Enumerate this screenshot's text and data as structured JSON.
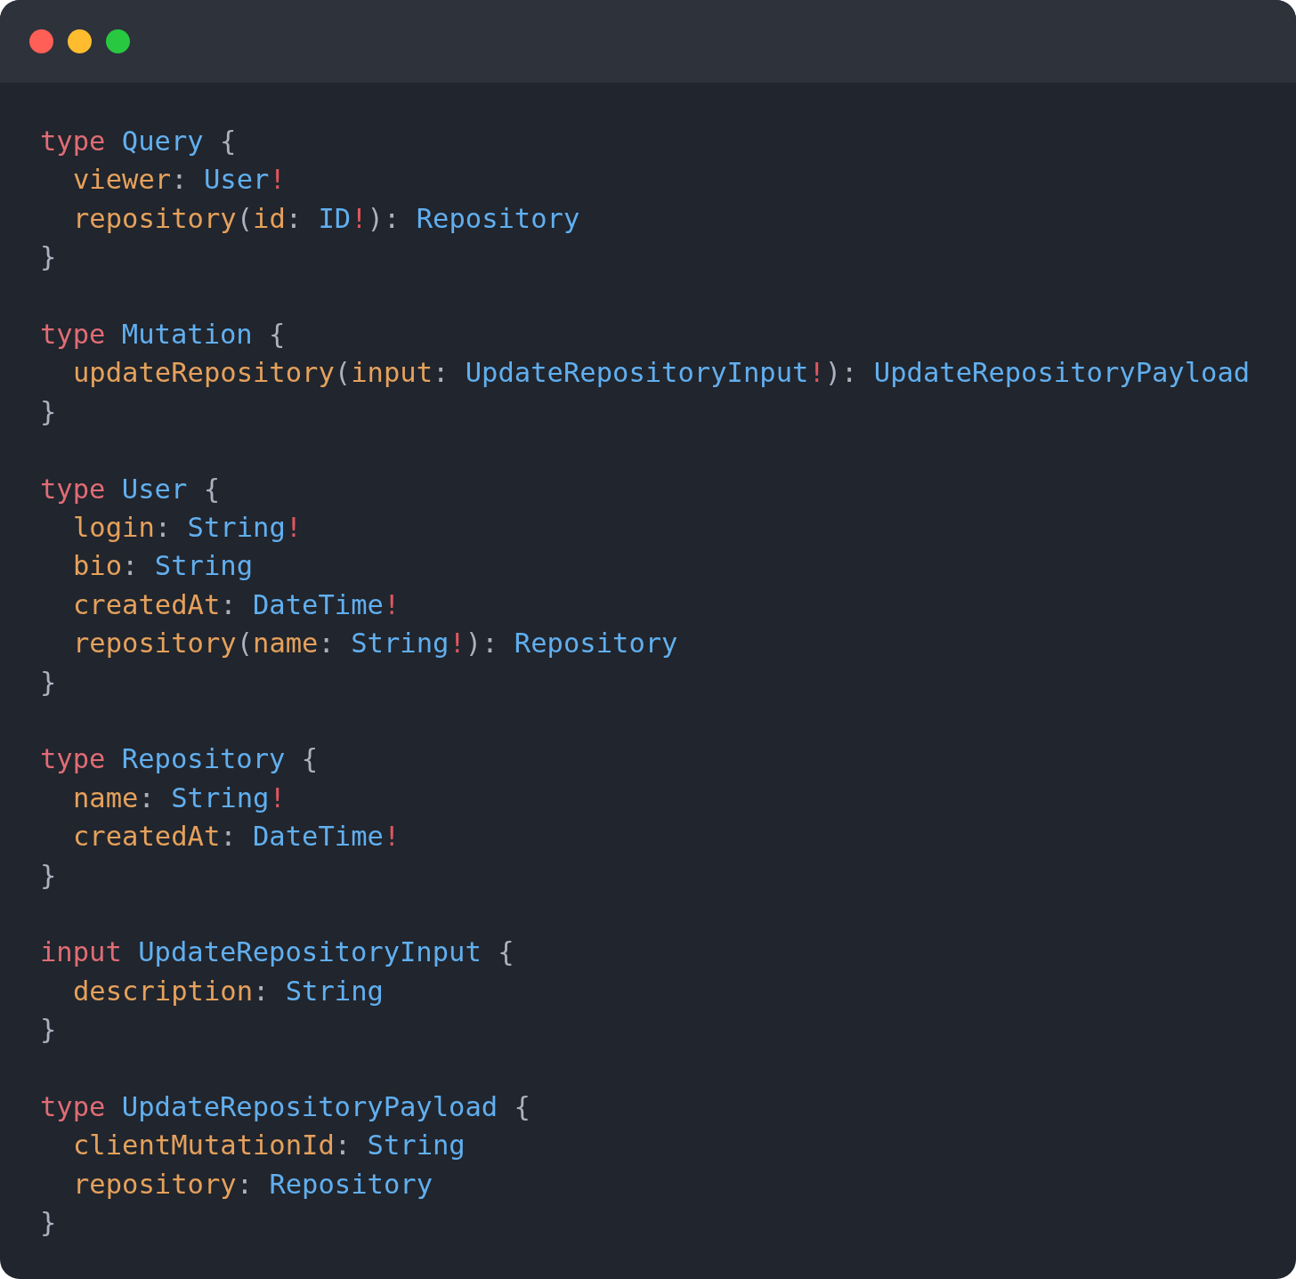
{
  "window": {
    "controls": [
      {
        "color": "#ff5f57"
      },
      {
        "color": "#febc2e"
      },
      {
        "color": "#28c840"
      }
    ]
  },
  "code": {
    "blocks": [
      {
        "header": [
          {
            "kind": "keyword",
            "t": "type "
          },
          {
            "kind": "type",
            "t": "Query"
          },
          {
            "kind": "punct",
            "t": " {"
          }
        ],
        "fields": [
          [
            {
              "kind": "field",
              "t": "viewer"
            },
            {
              "kind": "punct",
              "t": ": "
            },
            {
              "kind": "type",
              "t": "User"
            },
            {
              "kind": "bang",
              "t": "!"
            }
          ],
          [
            {
              "kind": "field",
              "t": "repository"
            },
            {
              "kind": "punct",
              "t": "("
            },
            {
              "kind": "field",
              "t": "id"
            },
            {
              "kind": "punct",
              "t": ": "
            },
            {
              "kind": "type",
              "t": "ID"
            },
            {
              "kind": "bang",
              "t": "!"
            },
            {
              "kind": "punct",
              "t": "): "
            },
            {
              "kind": "type",
              "t": "Repository"
            }
          ]
        ],
        "footer": "}"
      },
      {
        "header": [
          {
            "kind": "keyword",
            "t": "type "
          },
          {
            "kind": "type",
            "t": "Mutation"
          },
          {
            "kind": "punct",
            "t": " {"
          }
        ],
        "fields": [
          [
            {
              "kind": "field",
              "t": "updateRepository"
            },
            {
              "kind": "punct",
              "t": "("
            },
            {
              "kind": "field",
              "t": "input"
            },
            {
              "kind": "punct",
              "t": ": "
            },
            {
              "kind": "type",
              "t": "UpdateRepositoryInput"
            },
            {
              "kind": "bang",
              "t": "!"
            },
            {
              "kind": "punct",
              "t": "): "
            },
            {
              "kind": "type",
              "t": "UpdateRepositoryPayload"
            }
          ]
        ],
        "footer": "}"
      },
      {
        "header": [
          {
            "kind": "keyword",
            "t": "type "
          },
          {
            "kind": "type",
            "t": "User"
          },
          {
            "kind": "punct",
            "t": " {"
          }
        ],
        "fields": [
          [
            {
              "kind": "field",
              "t": "login"
            },
            {
              "kind": "punct",
              "t": ": "
            },
            {
              "kind": "type",
              "t": "String"
            },
            {
              "kind": "bang",
              "t": "!"
            }
          ],
          [
            {
              "kind": "field",
              "t": "bio"
            },
            {
              "kind": "punct",
              "t": ": "
            },
            {
              "kind": "type",
              "t": "String"
            }
          ],
          [
            {
              "kind": "field",
              "t": "createdAt"
            },
            {
              "kind": "punct",
              "t": ": "
            },
            {
              "kind": "type",
              "t": "DateTime"
            },
            {
              "kind": "bang",
              "t": "!"
            }
          ],
          [
            {
              "kind": "field",
              "t": "repository"
            },
            {
              "kind": "punct",
              "t": "("
            },
            {
              "kind": "field",
              "t": "name"
            },
            {
              "kind": "punct",
              "t": ": "
            },
            {
              "kind": "type",
              "t": "String"
            },
            {
              "kind": "bang",
              "t": "!"
            },
            {
              "kind": "punct",
              "t": "): "
            },
            {
              "kind": "type",
              "t": "Repository"
            }
          ]
        ],
        "footer": "}"
      },
      {
        "header": [
          {
            "kind": "keyword",
            "t": "type "
          },
          {
            "kind": "type",
            "t": "Repository"
          },
          {
            "kind": "punct",
            "t": " {"
          }
        ],
        "fields": [
          [
            {
              "kind": "field",
              "t": "name"
            },
            {
              "kind": "punct",
              "t": ": "
            },
            {
              "kind": "type",
              "t": "String"
            },
            {
              "kind": "bang",
              "t": "!"
            }
          ],
          [
            {
              "kind": "field",
              "t": "createdAt"
            },
            {
              "kind": "punct",
              "t": ": "
            },
            {
              "kind": "type",
              "t": "DateTime"
            },
            {
              "kind": "bang",
              "t": "!"
            }
          ]
        ],
        "footer": "}"
      },
      {
        "header": [
          {
            "kind": "keyword",
            "t": "input "
          },
          {
            "kind": "type",
            "t": "UpdateRepositoryInput"
          },
          {
            "kind": "punct",
            "t": " {"
          }
        ],
        "fields": [
          [
            {
              "kind": "field",
              "t": "description"
            },
            {
              "kind": "punct",
              "t": ": "
            },
            {
              "kind": "type",
              "t": "String"
            }
          ]
        ],
        "footer": "}"
      },
      {
        "header": [
          {
            "kind": "keyword",
            "t": "type "
          },
          {
            "kind": "type",
            "t": "UpdateRepositoryPayload"
          },
          {
            "kind": "punct",
            "t": " {"
          }
        ],
        "fields": [
          [
            {
              "kind": "field",
              "t": "clientMutationId"
            },
            {
              "kind": "punct",
              "t": ": "
            },
            {
              "kind": "type",
              "t": "String"
            }
          ],
          [
            {
              "kind": "field",
              "t": "repository"
            },
            {
              "kind": "punct",
              "t": ": "
            },
            {
              "kind": "type",
              "t": "Repository"
            }
          ]
        ],
        "footer": "}"
      }
    ]
  }
}
